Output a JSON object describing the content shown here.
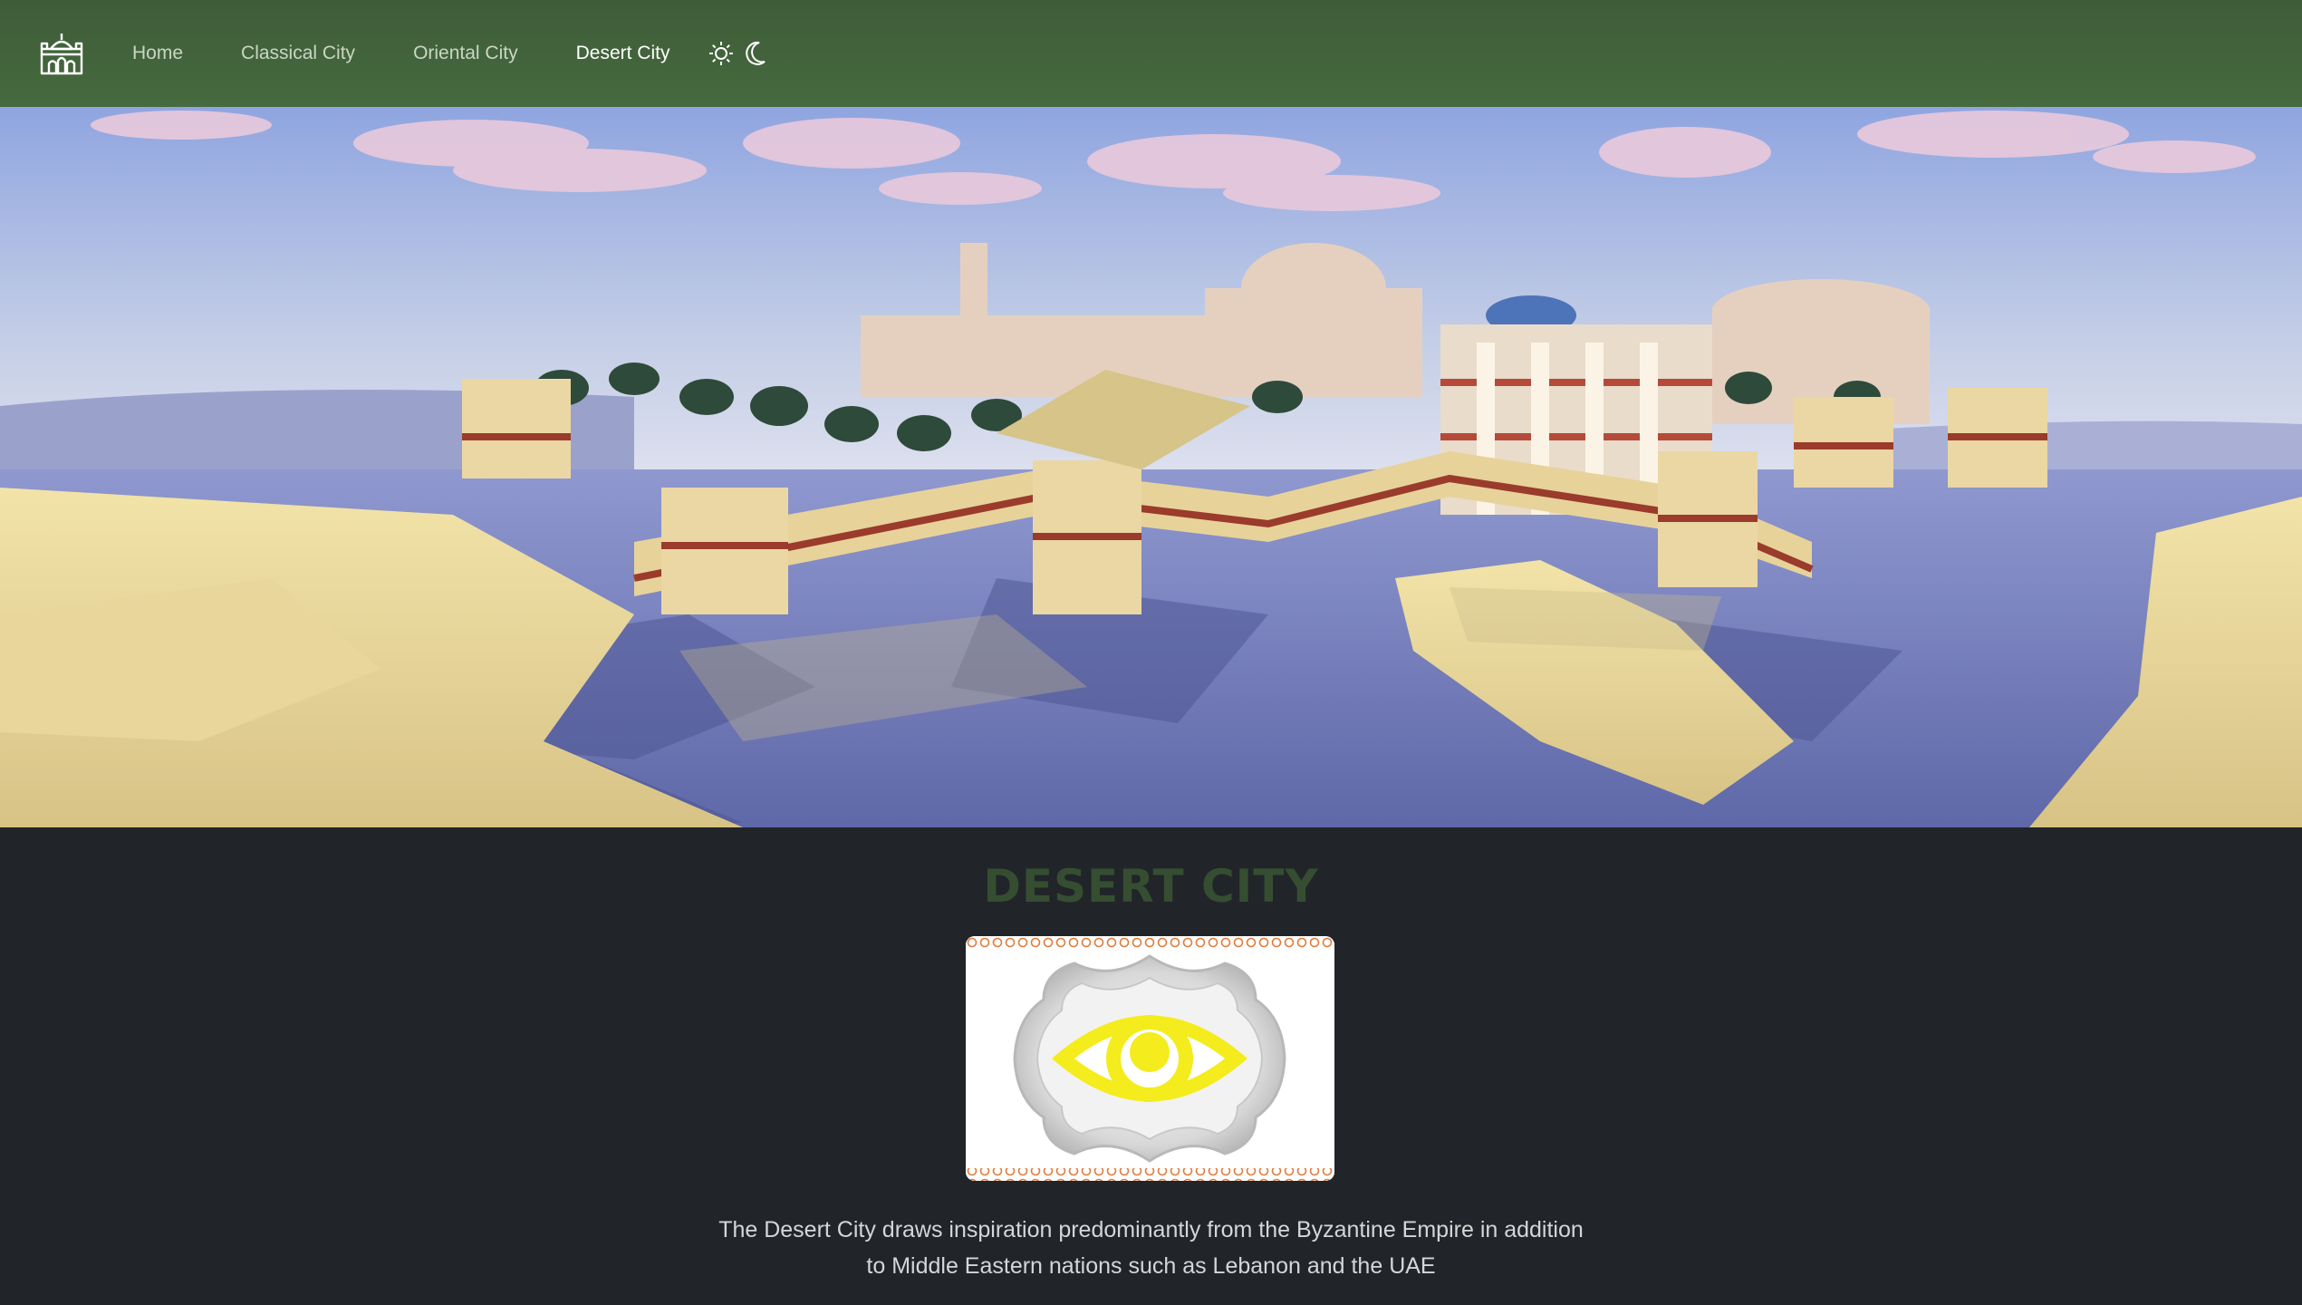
{
  "navbar": {
    "brand_icon": "palace-icon",
    "links": [
      {
        "label": "Home",
        "active": false
      },
      {
        "label": "Classical City",
        "active": false
      },
      {
        "label": "Oriental City",
        "active": false
      },
      {
        "label": "Desert City",
        "active": true
      }
    ],
    "theme_icons": [
      "sun-icon",
      "moon-icon"
    ],
    "background_color": "#426339"
  },
  "hero": {
    "image": "desert-city-panorama"
  },
  "main": {
    "title": "DESERT CITY",
    "title_color": "#354e31",
    "emblem": "eye-emblem",
    "description_line1": "The Desert City draws inspiration predominantly from the Byzantine Empire in addition",
    "description_line2": "to Middle Eastern nations such as Lebanon and the UAE"
  }
}
